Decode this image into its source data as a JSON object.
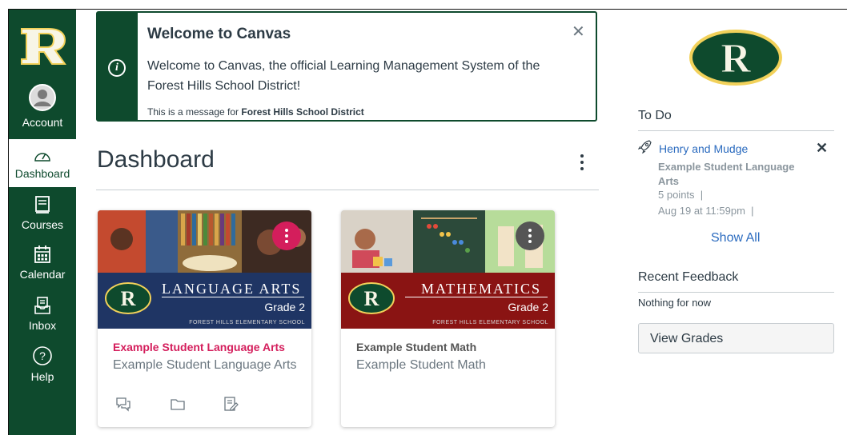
{
  "nav": {
    "items": [
      {
        "label": "Account",
        "icon": "account-icon"
      },
      {
        "label": "Dashboard",
        "icon": "dashboard-icon"
      },
      {
        "label": "Courses",
        "icon": "courses-icon"
      },
      {
        "label": "Calendar",
        "icon": "calendar-icon"
      },
      {
        "label": "Inbox",
        "icon": "inbox-icon"
      },
      {
        "label": "Help",
        "icon": "help-icon"
      }
    ],
    "active": "Dashboard",
    "brand_color": "#0e4a2d"
  },
  "banner": {
    "title": "Welcome to Canvas",
    "body": "Welcome to Canvas, the official Learning Management System of the Forest Hills School District!",
    "footer_prefix": "This is a message for ",
    "footer_org": "Forest Hills School District",
    "close_icon": "close-icon"
  },
  "dashboard": {
    "title": "Dashboard"
  },
  "cards": [
    {
      "name": "Example Student Language Arts",
      "subtitle": "Example Student Language Arts",
      "banner_word": "LANGUAGE ARTS",
      "grade": "Grade 2",
      "school": "FOREST HILLS ELEMENTARY SCHOOL",
      "accent": "#d41e5c",
      "banner_bg": "#1f3564"
    },
    {
      "name": "Example Student Math",
      "subtitle": "Example Student Math",
      "banner_word": "MATHEMATICS",
      "grade": "Grade 2",
      "school": "FOREST HILLS ELEMENTARY SCHOOL",
      "accent": "#555555",
      "banner_bg": "#8a1413"
    }
  ],
  "sidebar": {
    "todo_heading": "To Do",
    "todo_item": {
      "title": "Henry and Mudge",
      "course": "Example Student Language Arts",
      "points": "5 points",
      "due": "Aug 19 at 11:59pm"
    },
    "show_all": "Show All",
    "feedback_heading": "Recent Feedback",
    "feedback_empty": "Nothing for now",
    "view_grades": "View Grades"
  }
}
